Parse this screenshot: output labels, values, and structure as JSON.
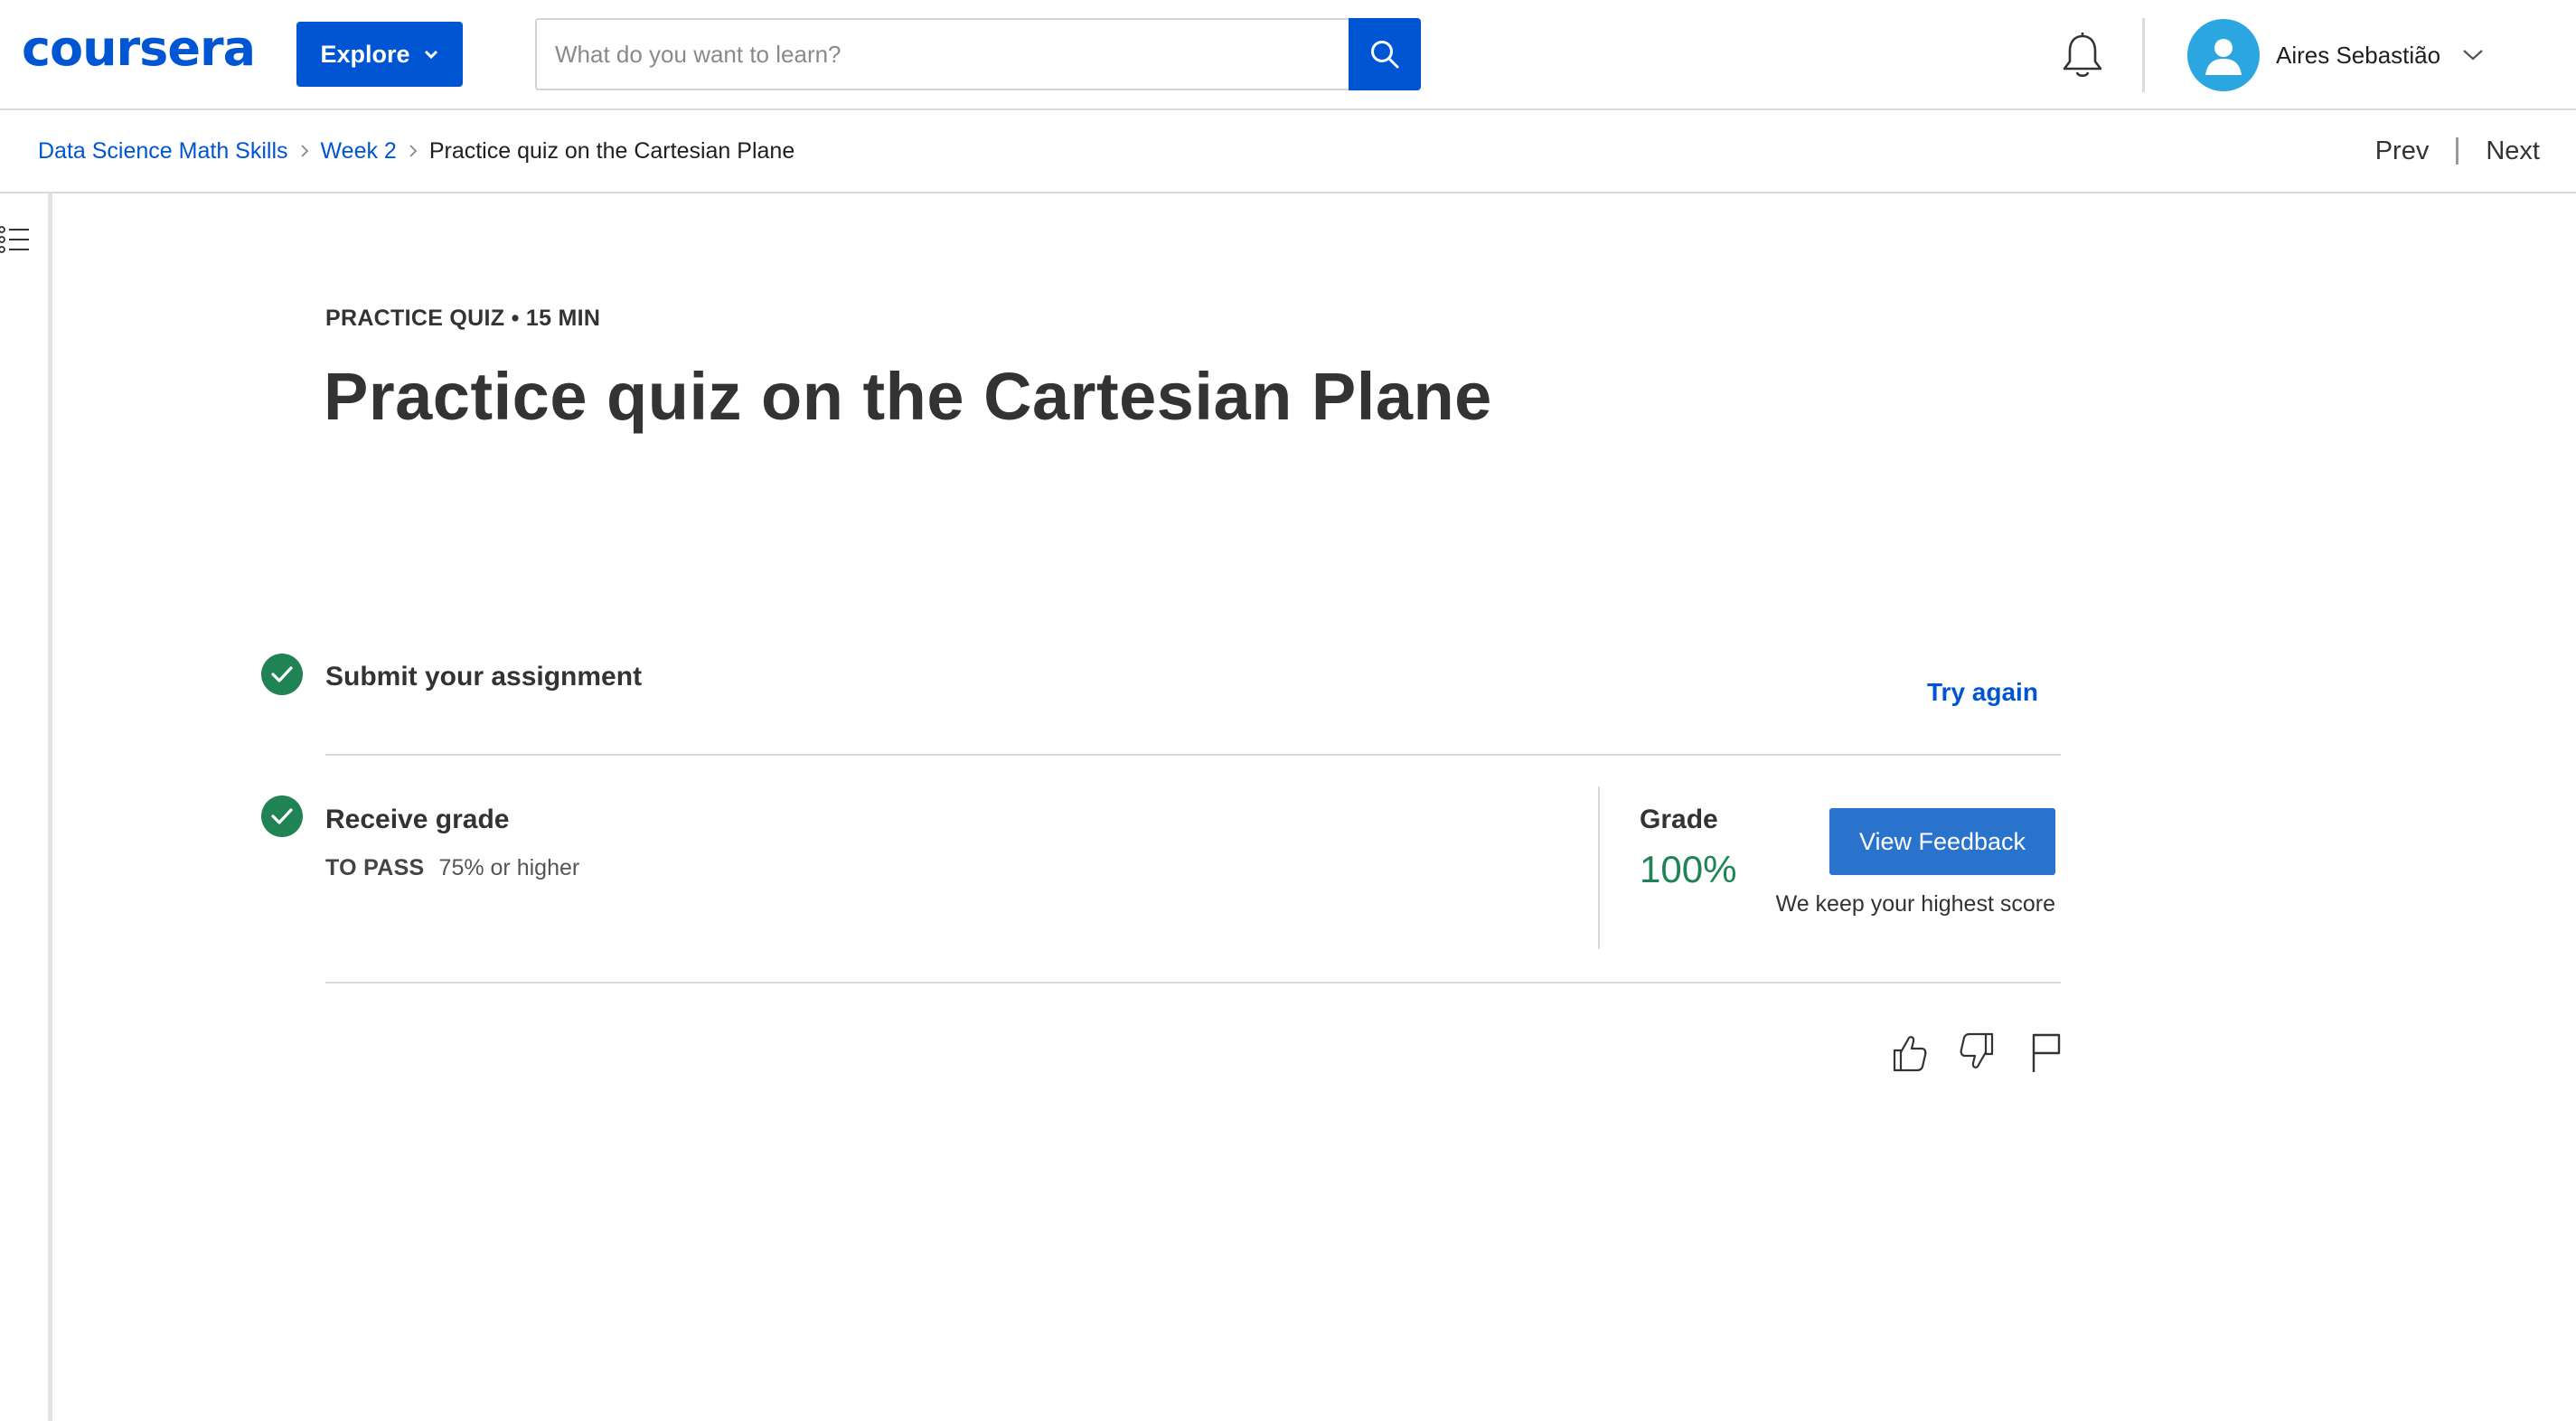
{
  "header": {
    "logo": "coursera",
    "explore_label": "Explore",
    "search_placeholder": "What do you want to learn?",
    "user_name": "Aires Sebastião"
  },
  "breadcrumb": {
    "items": [
      "Data Science Math Skills",
      "Week 2"
    ],
    "current": "Practice quiz on the Cartesian Plane"
  },
  "nav": {
    "prev": "Prev",
    "next": "Next"
  },
  "quiz": {
    "meta": "PRACTICE QUIZ • 15 MIN",
    "title": "Practice quiz on the Cartesian Plane",
    "submit_label": "Submit your assignment",
    "try_again": "Try again",
    "receive_label": "Receive grade",
    "to_pass_label": "TO PASS",
    "to_pass_value": "75% or higher",
    "grade_label": "Grade",
    "grade_value": "100%",
    "view_feedback": "View Feedback",
    "keep_note": "We keep your highest score"
  },
  "colors": {
    "brand": "#0056d2",
    "success": "#1f8354",
    "button": "#2a73cc"
  },
  "icons": [
    "search-icon",
    "bell-icon",
    "avatar-icon",
    "chevron-down-icon",
    "outline-icon",
    "check-icon",
    "thumbs-up-icon",
    "thumbs-down-icon",
    "flag-icon"
  ]
}
